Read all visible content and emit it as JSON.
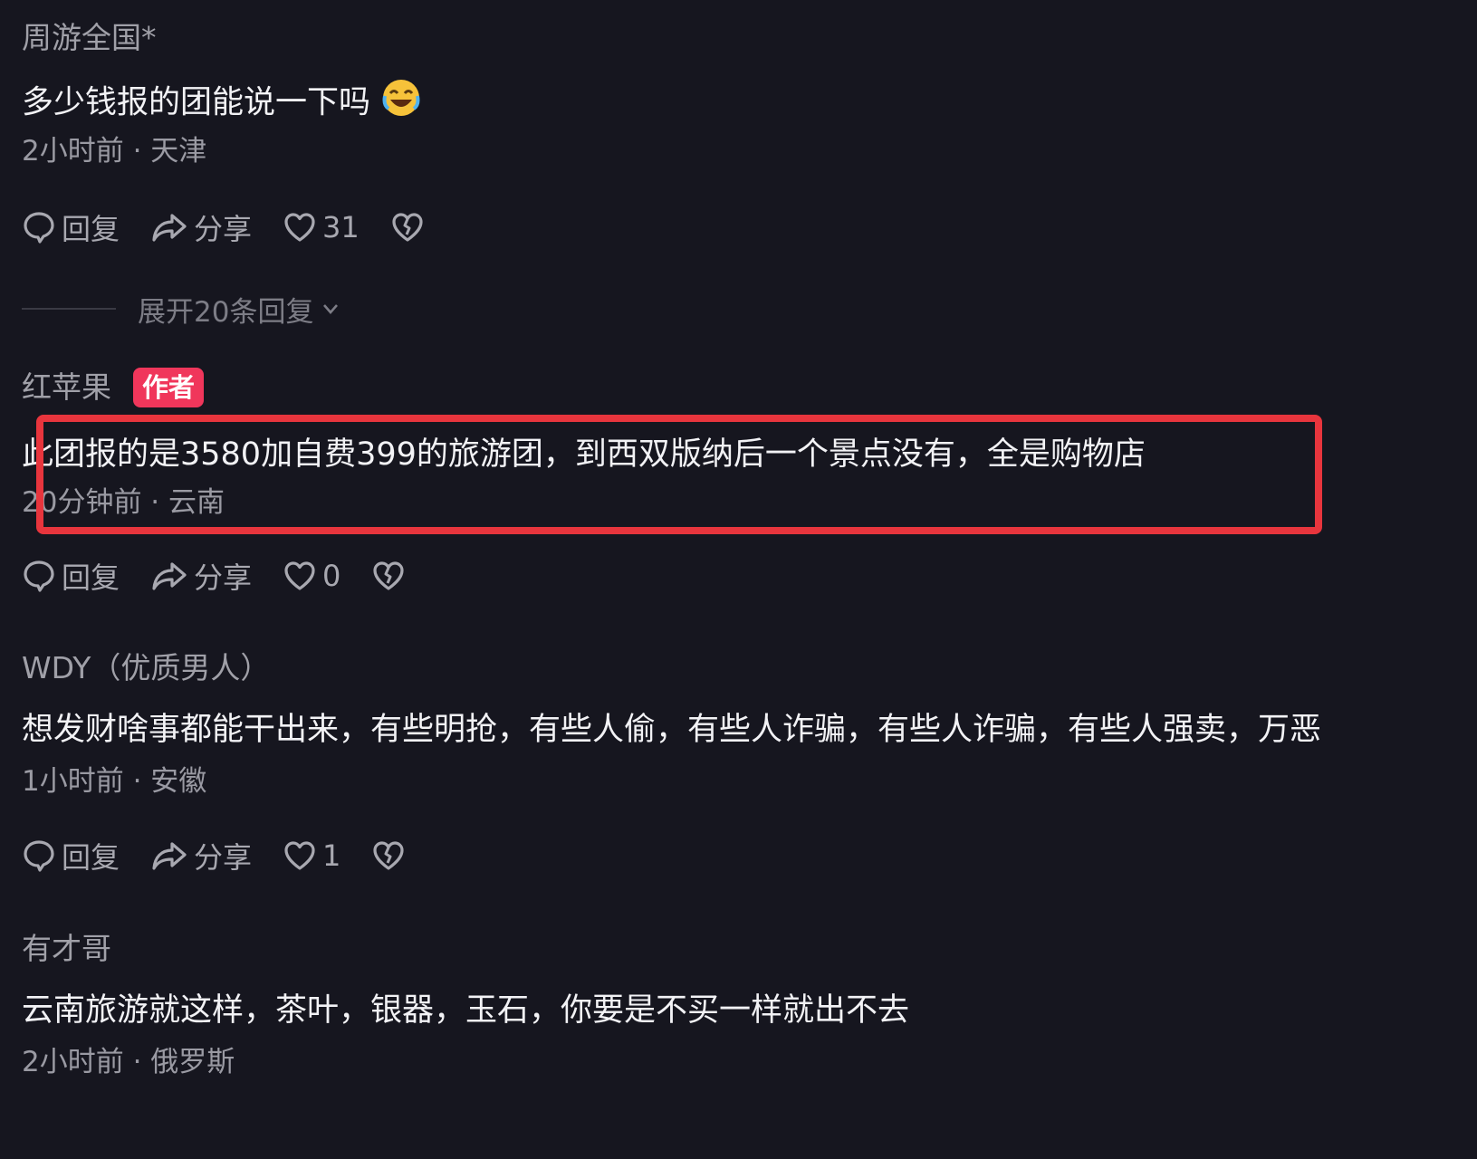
{
  "comments": [
    {
      "username": "周游全国*",
      "content": "多少钱报的团能说一下吗",
      "emoji": "laughing-emoji",
      "meta": "2小时前 · 天津",
      "actions": {
        "reply": "回复",
        "share": "分享",
        "likes": "31"
      },
      "expand_replies": "展开20条回复"
    },
    {
      "username": "红苹果",
      "badge": "作者",
      "content": "此团报的是3580加自费399的旅游团，到西双版纳后一个景点没有，全是购物店",
      "meta": "20分钟前 · 云南",
      "actions": {
        "reply": "回复",
        "share": "分享",
        "likes": "0"
      },
      "highlight_color": "#e8353d"
    },
    {
      "username": "WDY（优质男人）",
      "content": "想发财啥事都能干出来，有些明抢，有些人偷，有些人诈骗，有些人诈骗，有些人强卖，万恶",
      "meta": "1小时前 · 安徽",
      "actions": {
        "reply": "回复",
        "share": "分享",
        "likes": "1"
      }
    },
    {
      "username": "有才哥",
      "content": "云南旅游就这样，茶叶，银器，玉石，你要是不买一样就出不去",
      "meta": "2小时前 · 俄罗斯"
    }
  ],
  "colors": {
    "background": "#16161f",
    "author_badge": "#f0365b",
    "highlight": "#e8353d"
  },
  "icons": [
    "comment-bubble-icon",
    "share-arrow-icon",
    "heart-icon",
    "broken-heart-icon",
    "chevron-down-icon"
  ]
}
